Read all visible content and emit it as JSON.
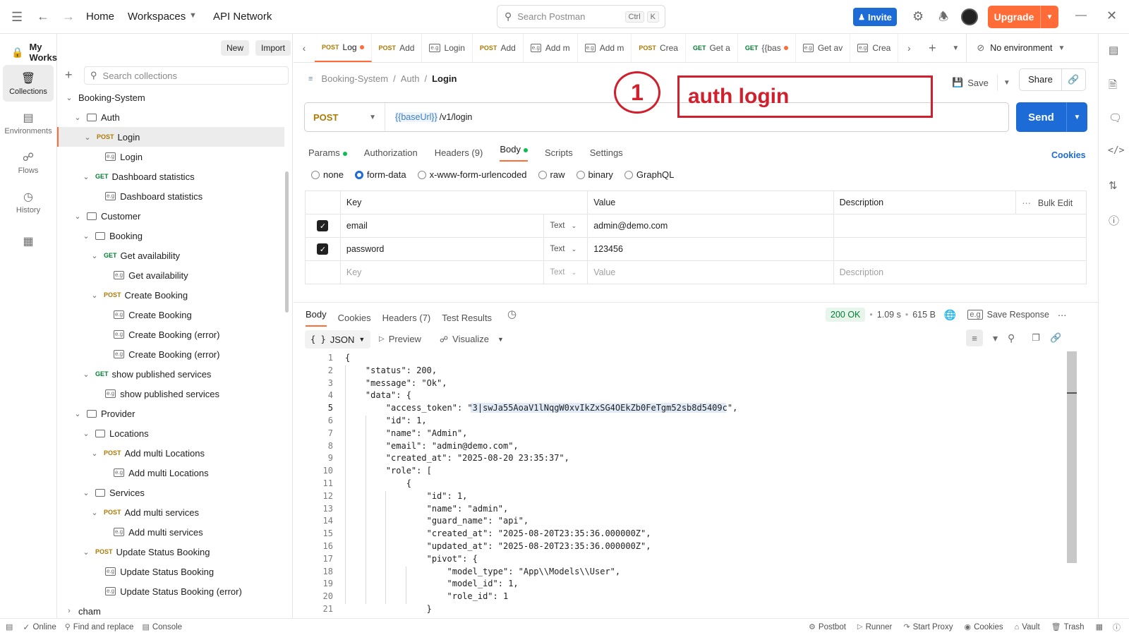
{
  "topbar": {
    "home": "Home",
    "workspaces": "Workspaces",
    "api_network": "API Network",
    "search_placeholder": "Search Postman",
    "shortcut_ctrl": "Ctrl",
    "shortcut_k": "K",
    "invite": "Invite",
    "upgrade": "Upgrade"
  },
  "sidebar": {
    "workspace": "My Workspace",
    "new": "New",
    "import": "Import",
    "search_placeholder": "Search collections",
    "rail": [
      {
        "label": "Collections",
        "icon": "collections-icon"
      },
      {
        "label": "Environments",
        "icon": "environments-icon"
      },
      {
        "label": "Flows",
        "icon": "flows-icon"
      },
      {
        "label": "History",
        "icon": "history-icon"
      }
    ],
    "tree": [
      {
        "label": "Booking-System",
        "kind": "collection",
        "depth": 0,
        "open": true
      },
      {
        "label": "Auth",
        "kind": "folder",
        "depth": 1,
        "open": true
      },
      {
        "label": "Login",
        "kind": "request",
        "method": "POST",
        "depth": 2,
        "open": true,
        "selected": true
      },
      {
        "label": "Login",
        "kind": "example",
        "depth": 3
      },
      {
        "label": "Dashboard statistics",
        "kind": "request",
        "method": "GET",
        "depth": 2,
        "open": true
      },
      {
        "label": "Dashboard statistics",
        "kind": "example",
        "depth": 3
      },
      {
        "label": "Customer",
        "kind": "folder",
        "depth": 1,
        "open": true
      },
      {
        "label": "Booking",
        "kind": "folder",
        "depth": 2,
        "open": true
      },
      {
        "label": "Get availability",
        "kind": "request",
        "method": "GET",
        "depth": 3,
        "open": true
      },
      {
        "label": "Get availability",
        "kind": "example",
        "depth": 4
      },
      {
        "label": "Create Booking",
        "kind": "request",
        "method": "POST",
        "depth": 3,
        "open": true
      },
      {
        "label": "Create Booking",
        "kind": "example",
        "depth": 4
      },
      {
        "label": "Create Booking (error)",
        "kind": "example",
        "depth": 4
      },
      {
        "label": "Create Booking (error)",
        "kind": "example",
        "depth": 4
      },
      {
        "label": "show published services",
        "kind": "request",
        "method": "GET",
        "depth": 2,
        "open": true
      },
      {
        "label": "show published services",
        "kind": "example",
        "depth": 3
      },
      {
        "label": "Provider",
        "kind": "folder",
        "depth": 1,
        "open": true
      },
      {
        "label": "Locations",
        "kind": "folder",
        "depth": 2,
        "open": true
      },
      {
        "label": "Add multi Locations",
        "kind": "request",
        "method": "POST",
        "depth": 3,
        "open": true
      },
      {
        "label": "Add multi Locations",
        "kind": "example",
        "depth": 4
      },
      {
        "label": "Services",
        "kind": "folder",
        "depth": 2,
        "open": true
      },
      {
        "label": "Add multi services",
        "kind": "request",
        "method": "POST",
        "depth": 3,
        "open": true
      },
      {
        "label": "Add multi services",
        "kind": "example",
        "depth": 4
      },
      {
        "label": "Update Status Booking",
        "kind": "request",
        "method": "POST",
        "depth": 2,
        "open": true
      },
      {
        "label": "Update Status Booking",
        "kind": "example",
        "depth": 3
      },
      {
        "label": "Update Status Booking (error)",
        "kind": "example",
        "depth": 3
      },
      {
        "label": "cham",
        "kind": "collection",
        "depth": 0,
        "open": false
      }
    ]
  },
  "tabs": [
    {
      "method": "POST",
      "label": "Log",
      "dot": true,
      "active": true
    },
    {
      "method": "POST",
      "label": "Add",
      "dot": false
    },
    {
      "method": "",
      "label": "Login",
      "example": true
    },
    {
      "method": "POST",
      "label": "Add",
      "dot": false
    },
    {
      "method": "",
      "label": "Add m",
      "example": true
    },
    {
      "method": "",
      "label": "Add m",
      "example": true
    },
    {
      "method": "POST",
      "label": "Crea",
      "dot": false
    },
    {
      "method": "GET",
      "label": "Get a",
      "dot": false
    },
    {
      "method": "GET",
      "label": "{{bas",
      "dot": true
    },
    {
      "method": "",
      "label": "Get av",
      "example": true
    },
    {
      "method": "",
      "label": "Crea",
      "example": true
    }
  ],
  "environment": "No environment",
  "breadcrumb": {
    "collection": "Booking-System",
    "folder": "Auth",
    "request": "Login"
  },
  "actions": {
    "save": "Save",
    "share": "Share"
  },
  "request": {
    "method": "POST",
    "url_var": "{{baseUrl}}",
    "url_path": "/v1/login",
    "send": "Send",
    "tabs": [
      "Params",
      "Authorization",
      "Headers (9)",
      "Body",
      "Scripts",
      "Settings"
    ],
    "cookies": "Cookies",
    "body_modes": [
      "none",
      "form-data",
      "x-www-form-urlencoded",
      "raw",
      "binary",
      "GraphQL"
    ],
    "body_mode_selected": "form-data",
    "table_headers": {
      "key": "Key",
      "value": "Value",
      "description": "Description",
      "bulk": "Bulk Edit"
    },
    "rows": [
      {
        "key": "email",
        "type": "Text",
        "value": "admin@demo.com",
        "checked": true
      },
      {
        "key": "password",
        "type": "Text",
        "value": "123456",
        "checked": true
      }
    ],
    "placeholder": {
      "key": "Key",
      "type": "Text",
      "value": "Value",
      "description": "Description"
    }
  },
  "response": {
    "tabs": [
      "Body",
      "Cookies",
      "Headers (7)",
      "Test Results"
    ],
    "status": "200 OK",
    "time": "1.09 s",
    "size": "615 B",
    "save_response": "Save Response",
    "format": "JSON",
    "preview": "Preview",
    "visualize": "Visualize",
    "code": [
      "{",
      "    \"status\": 200,",
      "    \"message\": \"Ok\",",
      "    \"data\": {",
      "        \"access_token\": \"3|swJa55AoaV1lNqgW0xvIkZxSG4OEkZb0FeTgm52sb8d5409c\",",
      "        \"id\": 1,",
      "        \"name\": \"Admin\",",
      "        \"email\": \"admin@demo.com\",",
      "        \"created_at\": \"2025-08-20 23:35:37\",",
      "        \"role\": [",
      "            {",
      "                \"id\": 1,",
      "                \"name\": \"admin\",",
      "                \"guard_name\": \"api\",",
      "                \"created_at\": \"2025-08-20T23:35:36.000000Z\",",
      "                \"updated_at\": \"2025-08-20T23:35:36.000000Z\",",
      "                \"pivot\": {",
      "                    \"model_type\": \"App\\\\Models\\\\User\",",
      "                    \"model_id\": 1,",
      "                    \"role_id\": 1",
      "                }"
    ]
  },
  "annotation": {
    "number": "1",
    "text": "auth login"
  },
  "statusbar": {
    "online": "Online",
    "find": "Find and replace",
    "console": "Console",
    "postbot": "Postbot",
    "runner": "Runner",
    "proxy": "Start Proxy",
    "cookies": "Cookies",
    "vault": "Vault",
    "trash": "Trash"
  },
  "colors": {
    "accent": "#ff6c37",
    "primary": "#1c6bd6",
    "post": "#ad7a03",
    "get": "#007f31",
    "annotation": "#d0202d"
  }
}
